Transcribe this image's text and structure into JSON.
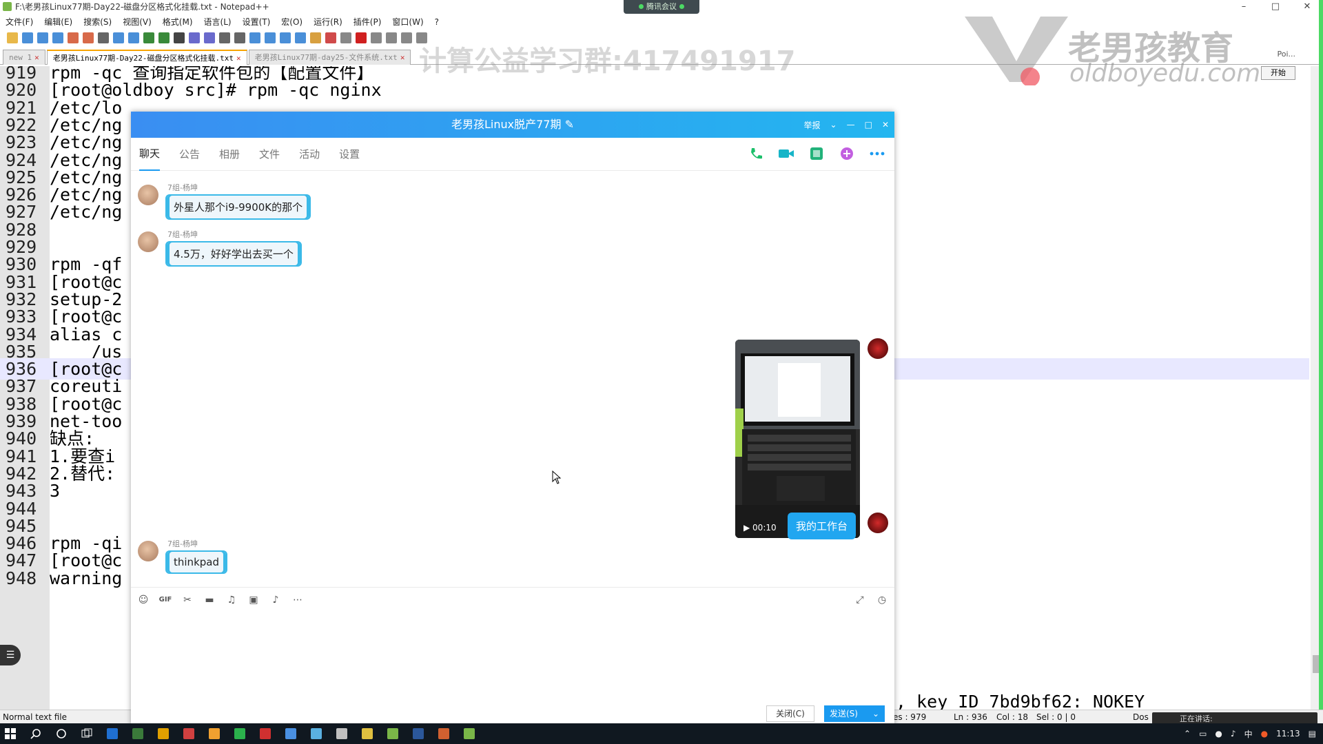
{
  "notepad": {
    "title": "F:\\老男孩Linux77期-Day22-磁盘分区格式化挂载.txt - Notepad++",
    "menu": [
      "文件(F)",
      "编辑(E)",
      "搜索(S)",
      "视图(V)",
      "格式(M)",
      "语言(L)",
      "设置(T)",
      "宏(O)",
      "运行(R)",
      "插件(P)",
      "窗口(W)",
      "?"
    ],
    "tabs": [
      {
        "label": "new 1",
        "active": false
      },
      {
        "label": "老男孩Linux77期-Day22-磁盘分区格式化挂载.txt",
        "active": true
      },
      {
        "label": "老男孩Linux77期-day25-文件系统.txt",
        "active": false
      }
    ],
    "start_button": "开始",
    "poi_label": "Poi...",
    "lines": [
      {
        "n": "919",
        "code": "rpm -qc 查询指定软件包的【配置文件】"
      },
      {
        "n": "920",
        "code": "[root@oldboy src]# rpm -qc nginx"
      },
      {
        "n": "921",
        "code": "/etc/lo"
      },
      {
        "n": "922",
        "code": "/etc/ng"
      },
      {
        "n": "923",
        "code": "/etc/ng"
      },
      {
        "n": "924",
        "code": "/etc/ng"
      },
      {
        "n": "925",
        "code": "/etc/ng"
      },
      {
        "n": "926",
        "code": "/etc/ng"
      },
      {
        "n": "927",
        "code": "/etc/ng"
      },
      {
        "n": "928",
        "code": ""
      },
      {
        "n": "929",
        "code": ""
      },
      {
        "n": "930",
        "code": "rpm -qf"
      },
      {
        "n": "931",
        "code": "[root@c"
      },
      {
        "n": "932",
        "code": "setup-2"
      },
      {
        "n": "933",
        "code": "[root@c"
      },
      {
        "n": "934",
        "code": "alias c"
      },
      {
        "n": "935",
        "code": "    /us"
      },
      {
        "n": "936",
        "code": "[root@c"
      },
      {
        "n": "937",
        "code": "coreuti"
      },
      {
        "n": "938",
        "code": "[root@c"
      },
      {
        "n": "939",
        "code": "net-too"
      },
      {
        "n": "940",
        "code": "缺点:"
      },
      {
        "n": "941",
        "code": "1.要查i"
      },
      {
        "n": "942",
        "code": "2.替代:"
      },
      {
        "n": "943",
        "code": "3"
      },
      {
        "n": "944",
        "code": ""
      },
      {
        "n": "945",
        "code": ""
      },
      {
        "n": "946",
        "code": "rpm -qi"
      },
      {
        "n": "947",
        "code": "[root@c"
      },
      {
        "n": "948",
        "code": "warning"
      }
    ],
    "right_fragment": ", key ID 7bd9bf62: NOKEY",
    "status": {
      "mode": "Normal text file",
      "length": "es : 979",
      "ln": "Ln : 936",
      "col": "Col : 18",
      "sel": "Sel : 0 | 0",
      "eol": "Dos"
    }
  },
  "overlay": {
    "meeting_pill": "腾讯会议",
    "watermark": "计算公益学习群:417491917",
    "logo_cn": "老男孩教育",
    "logo_en": "oldboyedu.com",
    "speaking": "正在讲话:"
  },
  "qq": {
    "title": "老男孩Linux脱产77期",
    "title_actions": {
      "report": "举报"
    },
    "tabs": [
      "聊天",
      "公告",
      "相册",
      "文件",
      "活动",
      "设置"
    ],
    "messages": [
      {
        "sender": "7组-杨坤",
        "text": "外星人那个i9-9900K的那个"
      },
      {
        "sender": "7组-杨坤",
        "text": "4.5万，好好学出去买一个"
      },
      {
        "sender": "7组-杨坤",
        "text": "thinkpad"
      }
    ],
    "my_message": "我的工作台",
    "video_duration": "00:10",
    "buttons": {
      "close": "关闭(C)",
      "send": "发送(S)"
    }
  },
  "taskbar": {
    "ime": "中",
    "time": "11:13"
  },
  "colors": {
    "qq_blue": "#23b6f0",
    "bubble_border": "#3ab9e8",
    "send_blue": "#1a9af0"
  }
}
